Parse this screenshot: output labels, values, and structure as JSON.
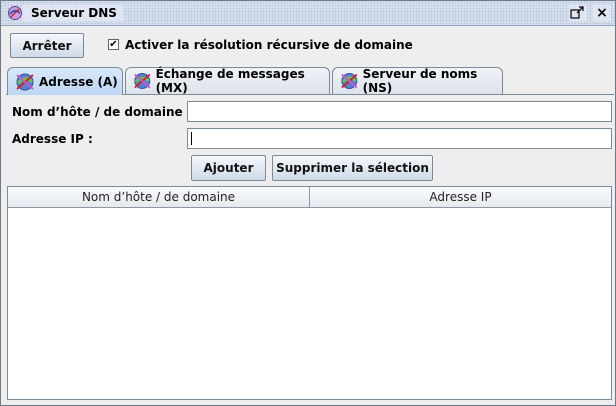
{
  "window": {
    "title": "Serveur DNS",
    "icon": "app-icon",
    "close_glyph": "×"
  },
  "toolbar": {
    "stop_label": "Arrêter",
    "recursive_label": "Activer la résolution récursive de domaine",
    "recursive_checked_glyph": "✔"
  },
  "tabs": [
    {
      "label": "Adresse (A)",
      "icon": "network-icon",
      "active": true
    },
    {
      "label": "Échange de messages (MX)",
      "icon": "network-icon",
      "active": false
    },
    {
      "label": "Serveur de noms (NS)",
      "icon": "network-icon",
      "active": false
    }
  ],
  "form": {
    "host_label": "Nom d’hôte / de domaine :",
    "host_value": "",
    "ip_label": "Adresse IP :",
    "ip_value": "",
    "add_label": "Ajouter",
    "delete_label": "Supprimer la sélection"
  },
  "table": {
    "columns": [
      "Nom d’hôte / de domaine",
      "Adresse IP"
    ],
    "rows": []
  }
}
